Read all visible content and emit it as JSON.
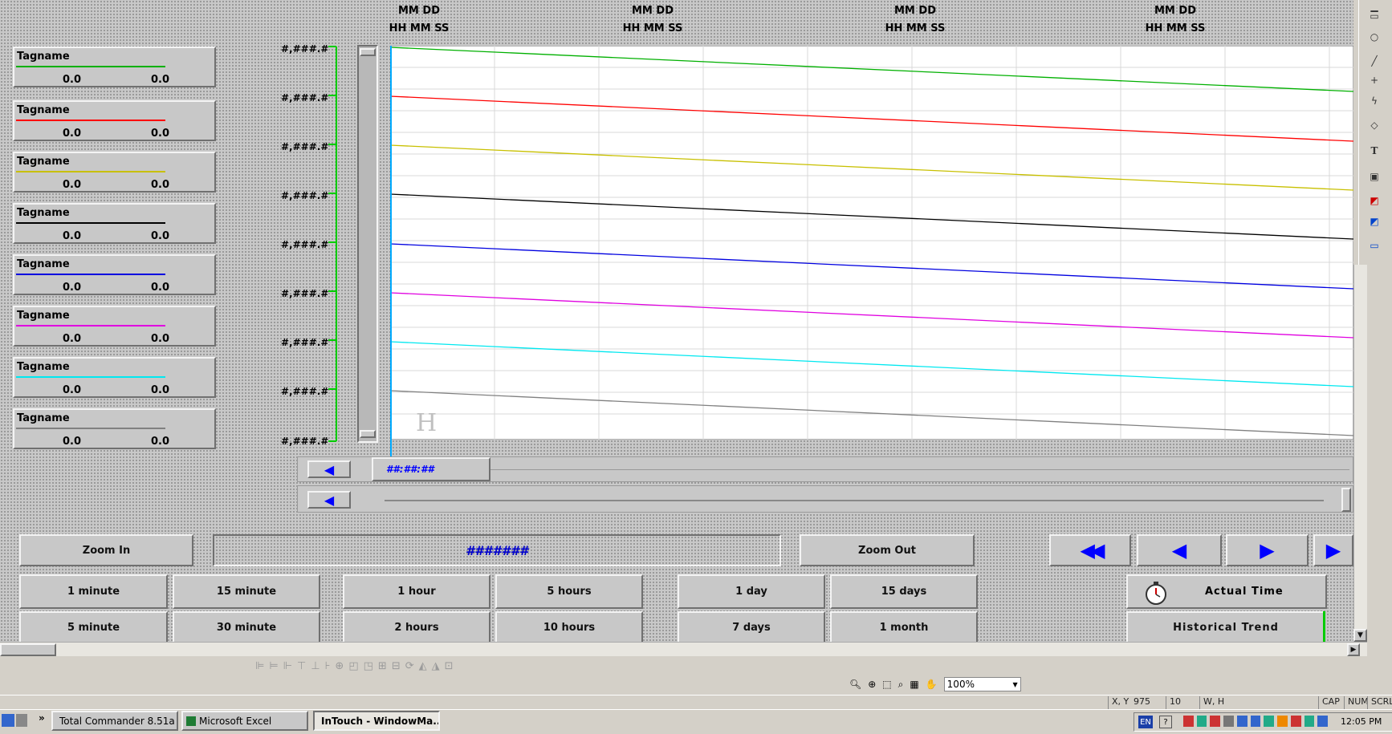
{
  "chart": {
    "timestamp_headers": [
      {
        "date": "MM DD",
        "time": "HH MM SS"
      },
      {
        "date": "MM DD",
        "time": "HH MM SS"
      },
      {
        "date": "MM DD",
        "time": "HH MM SS"
      },
      {
        "date": "MM DD",
        "time": "HH MM SS"
      }
    ],
    "y_labels": [
      "#,###.#",
      "#,###.#",
      "#,###.#",
      "#,###.#",
      "#,###.#",
      "#,###.#",
      "#,###.#",
      "#,###.#",
      "#,###.#"
    ],
    "watermark": "H",
    "scroll_time": "##:##:##"
  },
  "legend": [
    {
      "name": "Tagname",
      "color": "#00b000",
      "min": "0.0",
      "max": "0.0"
    },
    {
      "name": "Tagname",
      "color": "#ff0000",
      "min": "0.0",
      "max": "0.0"
    },
    {
      "name": "Tagname",
      "color": "#c8c000",
      "min": "0.0",
      "max": "0.0"
    },
    {
      "name": "Tagname",
      "color": "#000000",
      "min": "0.0",
      "max": "0.0"
    },
    {
      "name": "Tagname",
      "color": "#0000e0",
      "min": "0.0",
      "max": "0.0"
    },
    {
      "name": "Tagname",
      "color": "#e000e0",
      "min": "0.0",
      "max": "0.0"
    },
    {
      "name": "Tagname",
      "color": "#00e8f0",
      "min": "0.0",
      "max": "0.0"
    },
    {
      "name": "Tagname",
      "color": "#808080",
      "min": "0.0",
      "max": "0.0"
    }
  ],
  "controls": {
    "zoom_in": "Zoom In",
    "zoom_value": "#######",
    "zoom_out": "Zoom Out",
    "actual_time": "Actual Time",
    "historical_trend": "Historical Trend",
    "time_buttons_row1": [
      "1 minute",
      "15 minute",
      "1 hour",
      "5 hours",
      "1 day",
      "15 days"
    ],
    "time_buttons_row2": [
      "5 minute",
      "30 minute",
      "2 hours",
      "10 hours",
      "7 days",
      "1 month"
    ]
  },
  "zoom_toolbar": {
    "zoom_level": "100%"
  },
  "status_bar": {
    "xy_label": "X, Y",
    "xy_value": "975",
    "y_value": "10",
    "wh_label": "W, H",
    "cap": "CAP",
    "num": "NUM",
    "scrl": "SCRL"
  },
  "taskbar": {
    "items": [
      "Total Commander 8.51a ...",
      "Microsoft Excel",
      "InTouch - WindowMa..."
    ],
    "lang": "EN",
    "clock": "12:05 PM"
  },
  "colors": {
    "accent_blue": "#0000ff",
    "trend_bg": "#ffffff",
    "scale_green": "#00cc00"
  }
}
